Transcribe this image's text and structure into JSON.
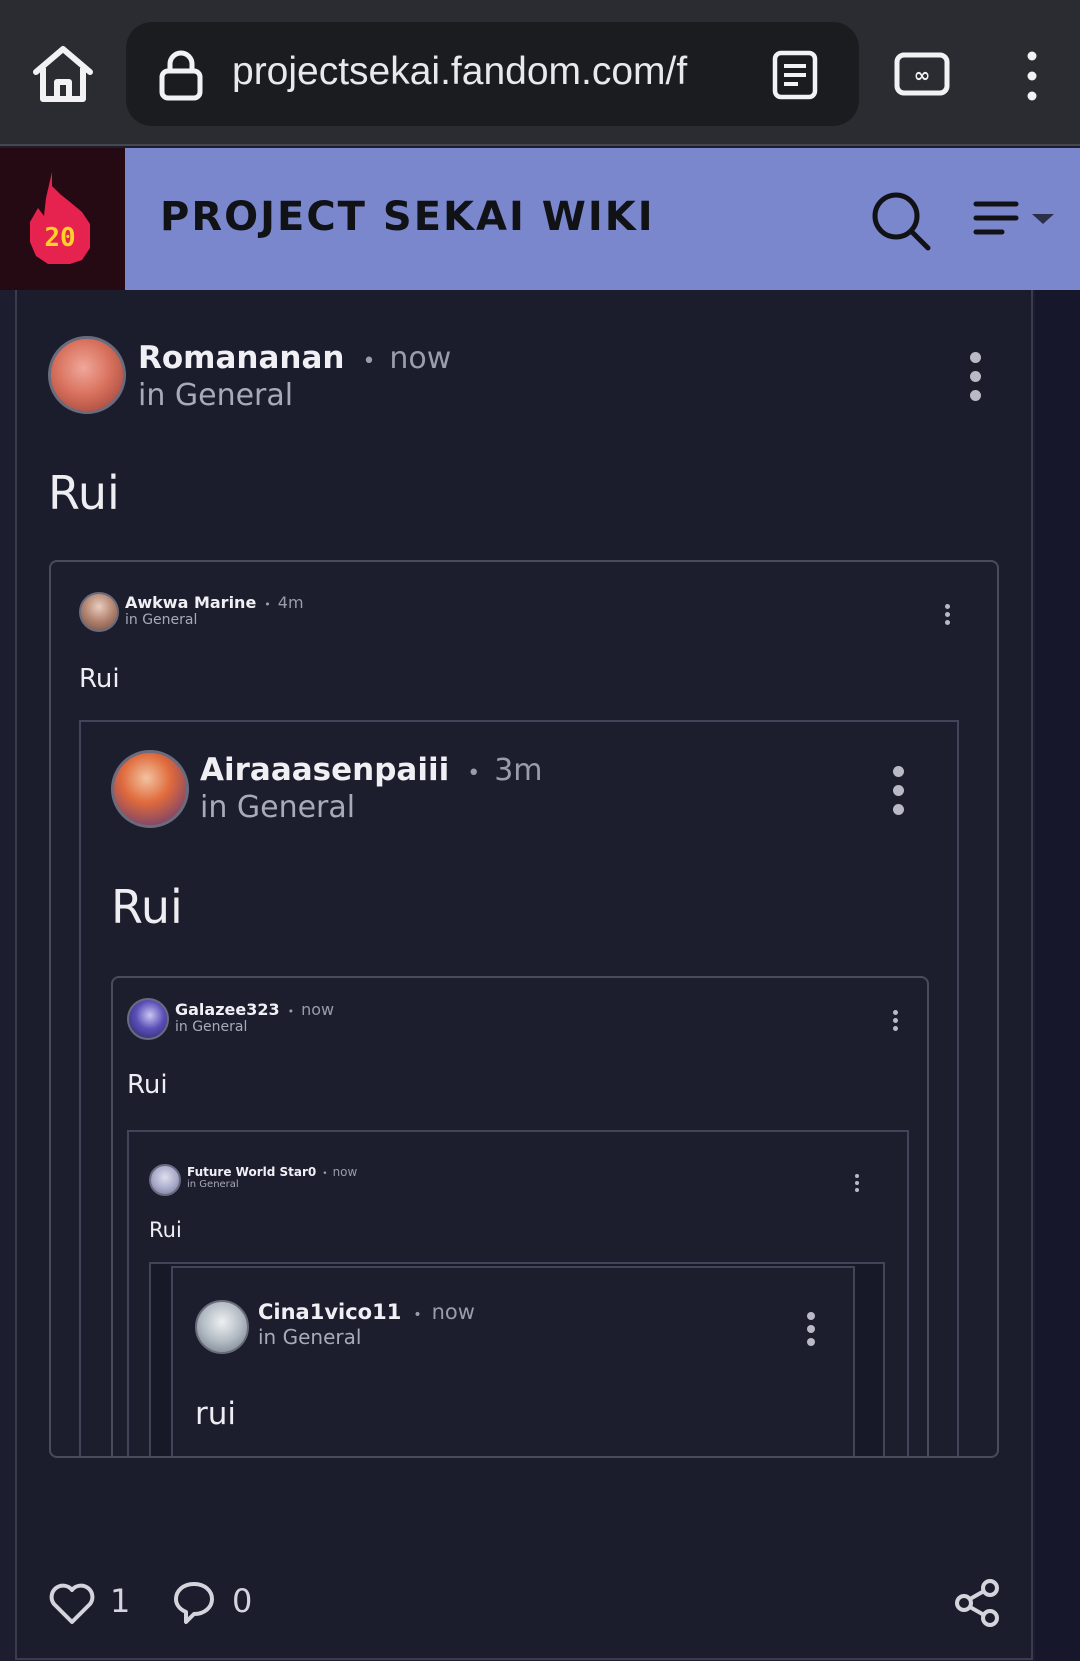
{
  "browser": {
    "url": "projectsekai.fandom.com/f",
    "icons": [
      "home-icon",
      "lock-icon",
      "reader-mode-icon",
      "tab-switcher-icon",
      "more-menu-icon"
    ]
  },
  "site": {
    "logo_text": "20",
    "title": "PROJECT SEKAI WIKI",
    "header_color": "#7a87cd",
    "icons": [
      "search-icon",
      "nav-menu-icon"
    ]
  },
  "post": {
    "author": "Romananan",
    "separator": "•",
    "time": "now",
    "category": "in General",
    "body": "Rui",
    "likes": "1",
    "comments": "0"
  },
  "quote1": {
    "author": "Awkwa Marine",
    "separator": "•",
    "time": "4m",
    "category": "in General",
    "body": "Rui"
  },
  "quote2": {
    "author": "Airaaasenpaiii",
    "separator": "•",
    "time": "3m",
    "category": "in General",
    "body": "Rui"
  },
  "quote3": {
    "author": "Galazee323",
    "separator": "•",
    "time": "now",
    "category": "in General",
    "body": "Rui"
  },
  "quote4": {
    "author": "Future World Star0",
    "separator": "•",
    "time": "now",
    "category": "in General",
    "body": "Rui"
  },
  "quote5": {
    "author": "Cina1vico11",
    "separator": "•",
    "time": "now",
    "category": "in General",
    "body": "rui"
  }
}
